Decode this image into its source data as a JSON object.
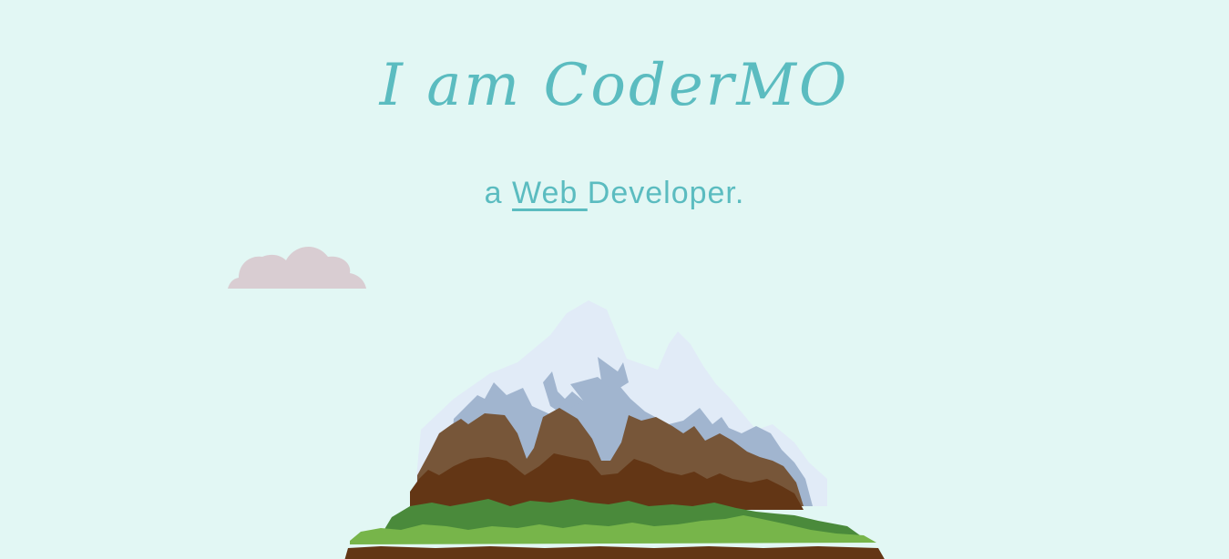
{
  "hero": {
    "title": "I am CoderMO",
    "subtitle_prefix": "a ",
    "subtitle_link": "Web ",
    "subtitle_suffix": "Developer."
  },
  "colors": {
    "background": "#e2f7f4",
    "text": "#5bbcc0",
    "cloud": "#d9cdd2",
    "snow_light": "#e1ebf7",
    "snow_shadow": "#a1b5cf",
    "rock_light": "#775639",
    "rock_dark": "#633615",
    "grass_dark": "#4a8a3b",
    "grass_light": "#77b54a"
  }
}
